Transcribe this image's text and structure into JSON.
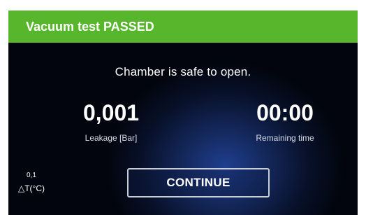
{
  "header": {
    "title": "Vacuum test PASSED"
  },
  "main": {
    "message": "Chamber is safe to open.",
    "leakage": {
      "value": "0,001",
      "label": "Leakage [Bar]"
    },
    "remaining_time": {
      "value": "00:00",
      "label": "Remaining time"
    },
    "delta_t": {
      "value": "0,1",
      "label": "△T(°C)"
    },
    "continue_label": "CONTINUE"
  },
  "colors": {
    "header_bg": "#58b62c",
    "panel_bg": "#02050d",
    "panel_glow": "#1f3f8f",
    "text": "#ffffff"
  }
}
